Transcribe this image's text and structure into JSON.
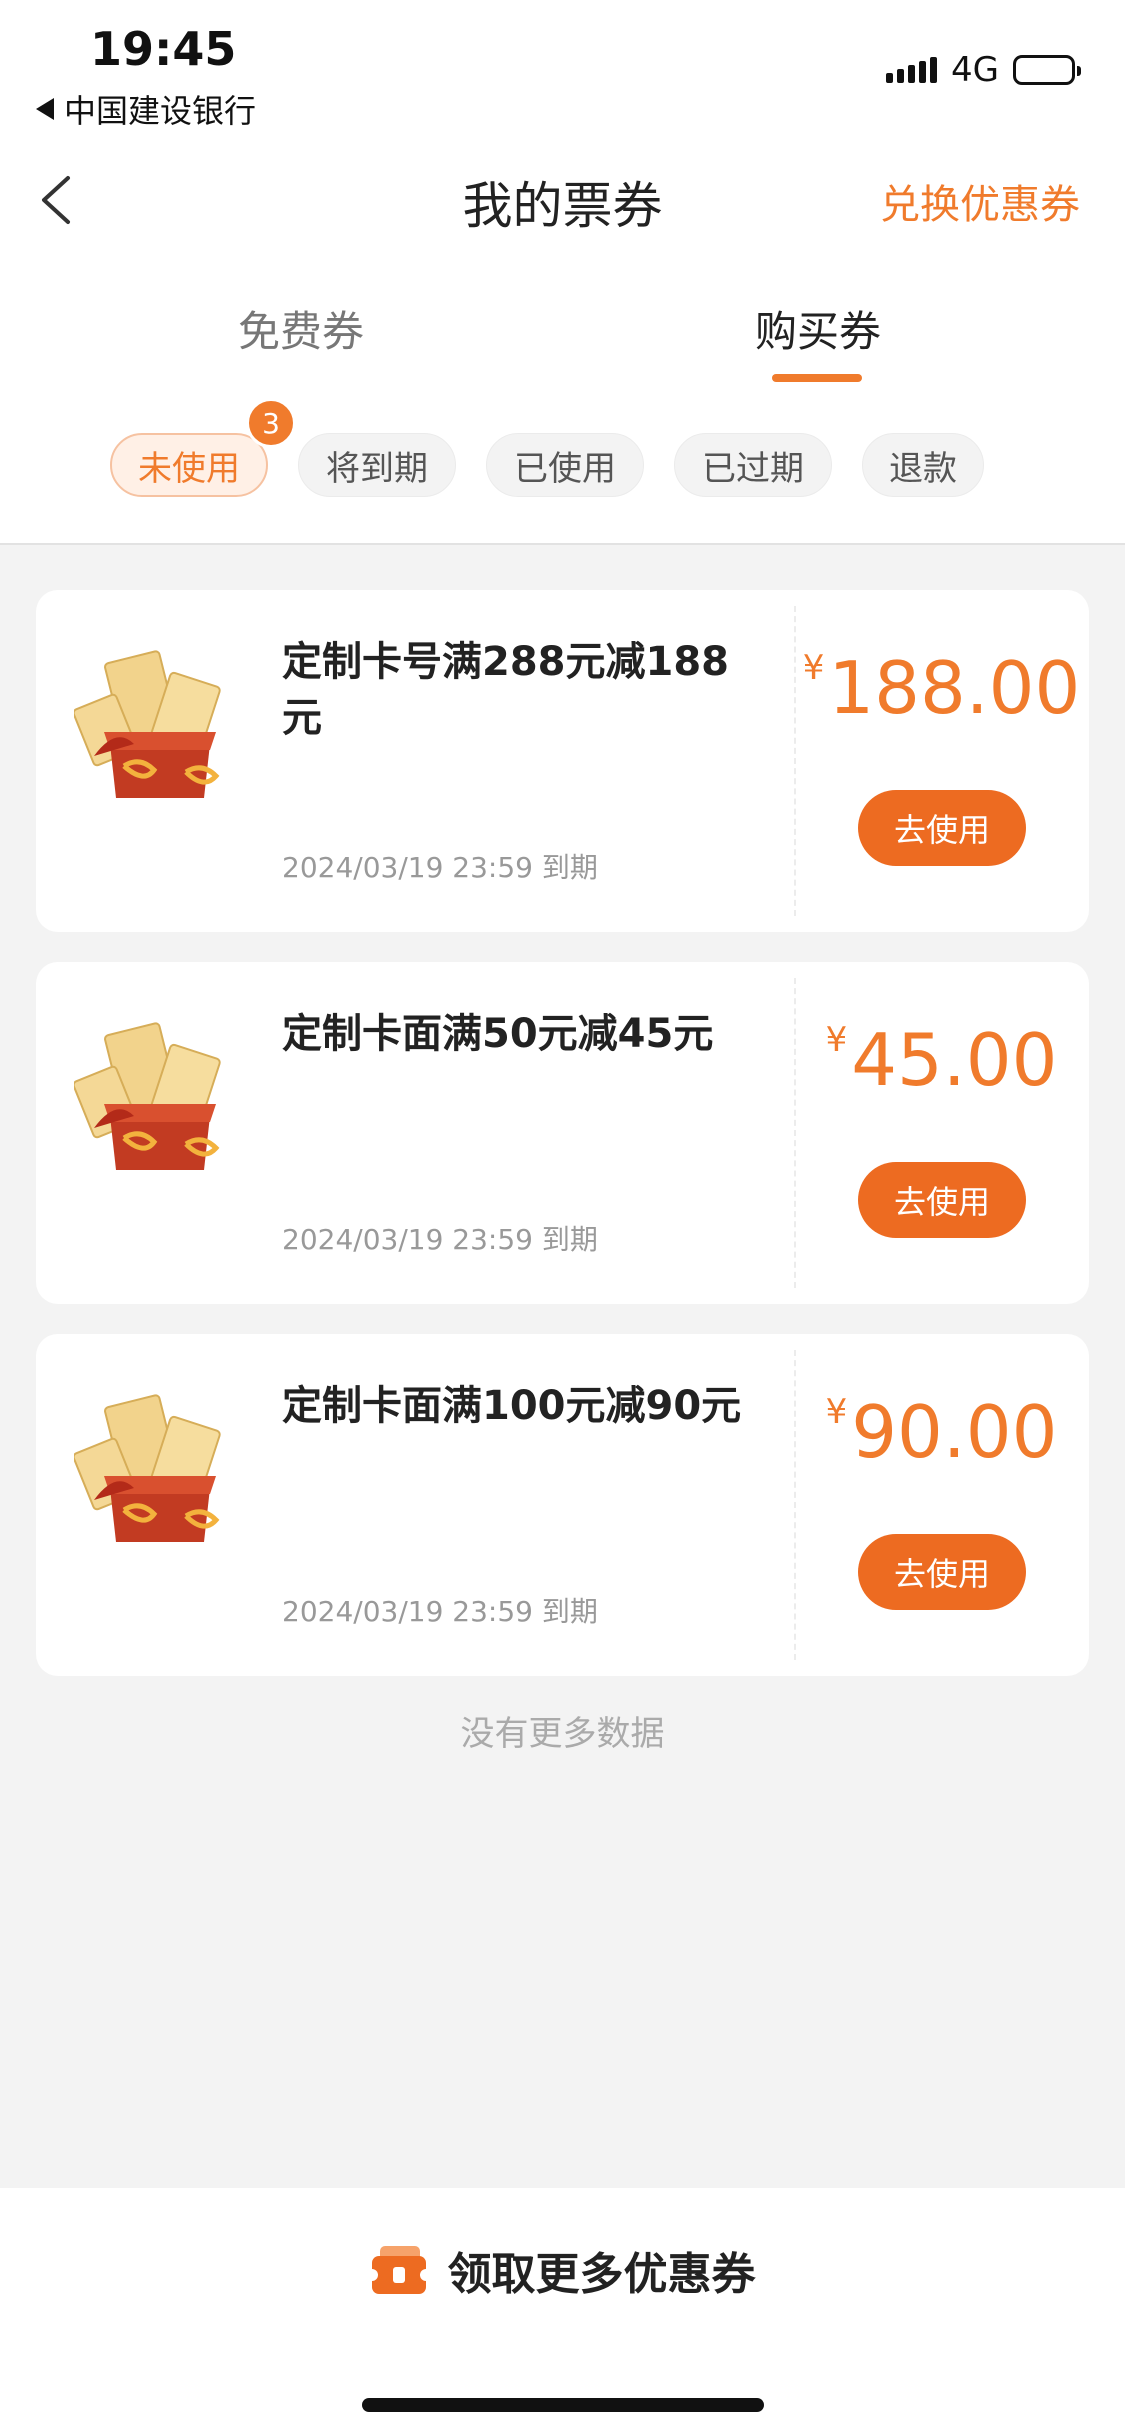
{
  "status_bar": {
    "time": "19:45",
    "back_app": "中国建设银行",
    "network": "4G"
  },
  "nav": {
    "title": "我的票券",
    "right_action": "兑换优惠券"
  },
  "tabs": [
    {
      "label": "免费券",
      "active": false
    },
    {
      "label": "购买券",
      "active": true
    }
  ],
  "filters": [
    {
      "label": "未使用",
      "active": true,
      "badge": "3"
    },
    {
      "label": "将到期",
      "active": false
    },
    {
      "label": "已使用",
      "active": false
    },
    {
      "label": "已过期",
      "active": false
    },
    {
      "label": "退款",
      "active": false
    }
  ],
  "coupons": [
    {
      "title": "定制卡号满288元减188元",
      "expiry": "2024/03/19 23:59 到期",
      "currency": "¥",
      "amount": "188.00",
      "button": "去使用"
    },
    {
      "title": "定制卡面满50元减45元",
      "expiry": "2024/03/19 23:59 到期",
      "currency": "¥",
      "amount": "45.00",
      "button": "去使用"
    },
    {
      "title": "定制卡面满100元减90元",
      "expiry": "2024/03/19 23:59 到期",
      "currency": "¥",
      "amount": "90.00",
      "button": "去使用"
    }
  ],
  "list_end": "没有更多数据",
  "bottom": {
    "label": "领取更多优惠券",
    "icon": "coupon-icon"
  },
  "colors": {
    "accent": "#f07b2c",
    "button": "#ed6b21",
    "background": "#f3f3f3"
  }
}
